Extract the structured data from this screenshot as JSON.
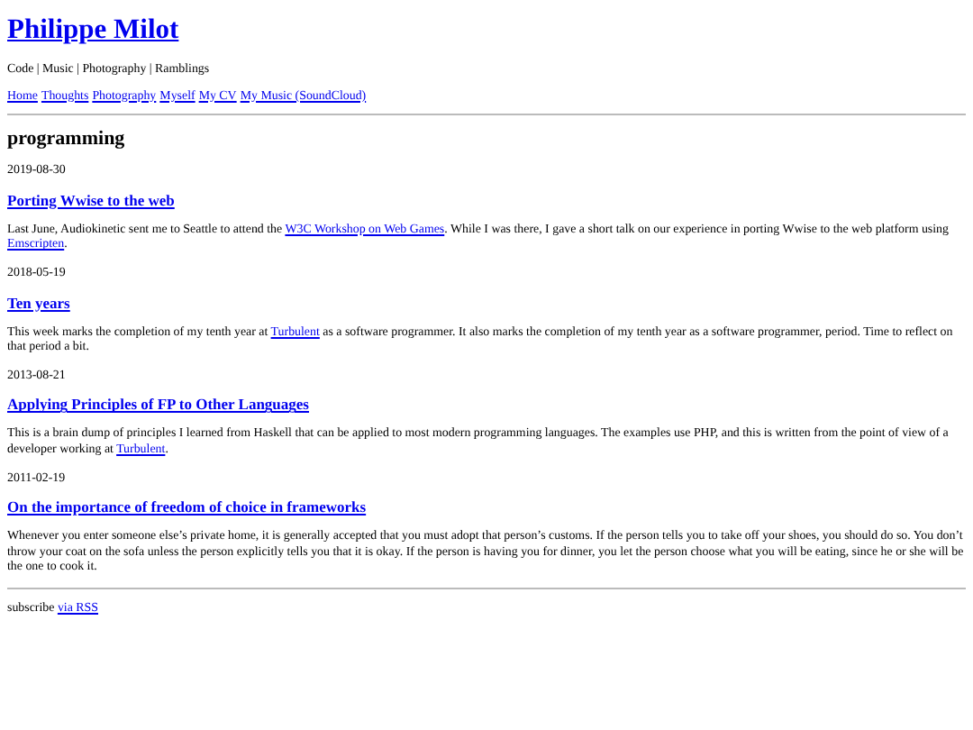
{
  "site": {
    "title": "Philippe Milot",
    "tagline": "Code | Music | Photography | Ramblings",
    "nav": [
      "Home",
      "Thoughts",
      "Photography",
      "Myself",
      "My CV",
      "My Music (SoundCloud)"
    ]
  },
  "category": "programming",
  "posts": [
    {
      "date": "2019-08-30",
      "title": "Porting Wwise to the web",
      "summary": [
        {
          "text": "Last June, Audiokinetic sent me to Seattle to attend the "
        },
        {
          "text": "W3C Workshop on Web Games",
          "link": true
        },
        {
          "text": ". While I was there, I gave a short talk on our experience in porting Wwise to the web platform using "
        },
        {
          "text": "Emscripten",
          "link": true
        },
        {
          "text": "."
        }
      ]
    },
    {
      "date": "2018-05-19",
      "title": "Ten years",
      "summary": [
        {
          "text": "This week marks the completion of my tenth year at "
        },
        {
          "text": "Turbulent",
          "link": true
        },
        {
          "text": " as a software programmer. It also marks the completion of my tenth year as a software programmer, period. Time to reflect on that period a bit."
        }
      ]
    },
    {
      "date": "2013-08-21",
      "title": "Applying Principles of FP to Other Languages",
      "summary": [
        {
          "text": "This is a brain dump of principles I learned from Haskell that can be applied to most modern programming languages. The examples use PHP, and this is written from the point of view of a developer working at "
        },
        {
          "text": "Turbulent",
          "link": true
        },
        {
          "text": "."
        }
      ]
    },
    {
      "date": "2011-02-19",
      "title": "On the importance of freedom of choice in frameworks",
      "summary": [
        {
          "text": "Whenever you enter someone else’s private home, it is generally accepted that you must adopt that person’s customs. If the person tells you to take off your shoes, you should do so. You don’t throw your coat on the sofa unless the person explicitly tells you that it is okay. If the person is having you for dinner, you let the person choose what you will be eating, since he or she will be the one to cook it."
        }
      ]
    }
  ],
  "footer": [
    {
      "text": "subscribe "
    },
    {
      "text": "via RSS",
      "link": true
    }
  ]
}
